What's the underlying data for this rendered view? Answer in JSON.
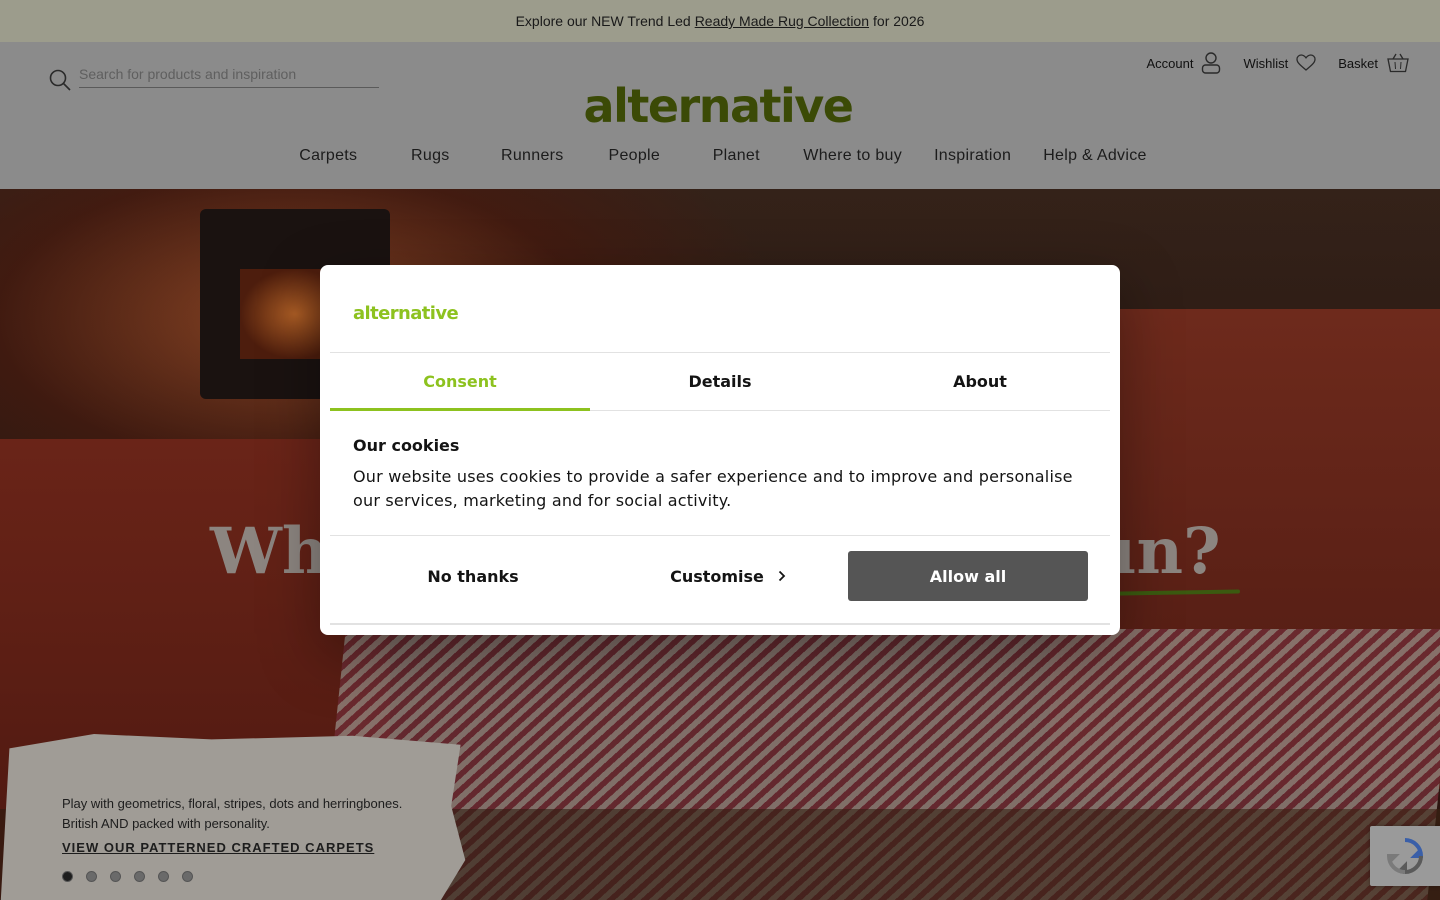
{
  "announcement": {
    "before": "Explore our NEW Trend Led",
    "link": "Ready Made Rug Collection",
    "after": "for 2026"
  },
  "header": {
    "search_placeholder": "Search for products and inspiration",
    "account_label": "Account",
    "wishlist_label": "Wishlist",
    "basket_label": "Basket",
    "logo_text": "alternative"
  },
  "nav": {
    "items": [
      "Carpets",
      "Rugs",
      "Runners",
      "People",
      "Planet",
      "Where to buy",
      "Inspiration",
      "Help & Advice"
    ]
  },
  "hero": {
    "headline_left": "Why",
    "headline_right": "un?",
    "description_line1": "Play with geometrics, floral, stripes, dots and herringbones.",
    "description_line2": "British AND packed with personality.",
    "cta": "VIEW OUR PATTERNED CRAFTED CARPETS",
    "slide_count": 6,
    "active_slide": 1
  },
  "cookie_modal": {
    "logo_text": "alternative",
    "tabs": [
      "Consent",
      "Details",
      "About"
    ],
    "active_tab": "Consent",
    "title": "Our cookies",
    "body": "Our website uses cookies to provide a safer experience and to improve and personalise our services, marketing and for social activity.",
    "buttons": {
      "no_thanks": "No thanks",
      "customise": "Customise",
      "allow_all": "Allow all"
    }
  },
  "colors": {
    "brand_green": "#8dc21f",
    "logo_dark_green": "#3b4a06",
    "allow_button": "#555555"
  }
}
